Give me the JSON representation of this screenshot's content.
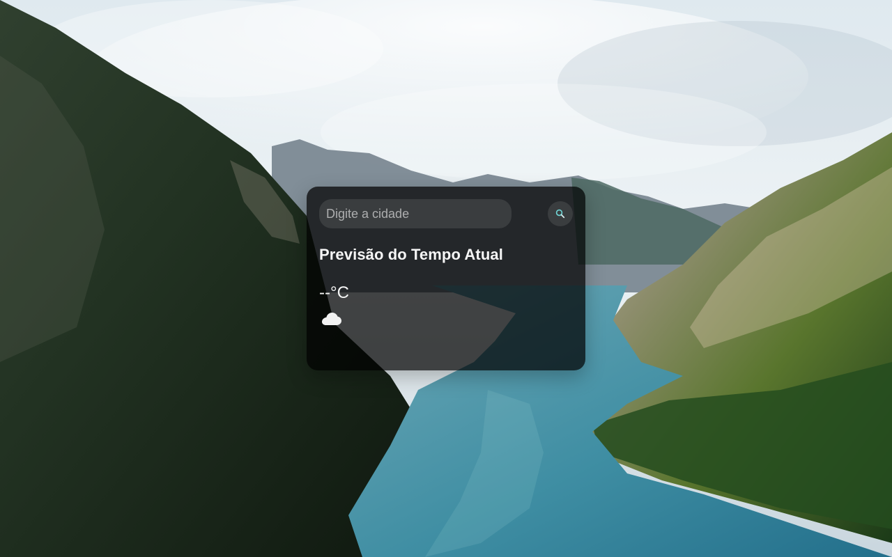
{
  "search": {
    "placeholder": "Digite a cidade",
    "button_icon": "search-icon"
  },
  "weather": {
    "title": "Previsão do Tempo Atual",
    "temperature": "--°C",
    "condition_icon": "cloud-icon"
  },
  "colors": {
    "card_background": "#000000",
    "text_primary": "#f5f5f5",
    "search_icon_accent": "#6fd3d3"
  }
}
